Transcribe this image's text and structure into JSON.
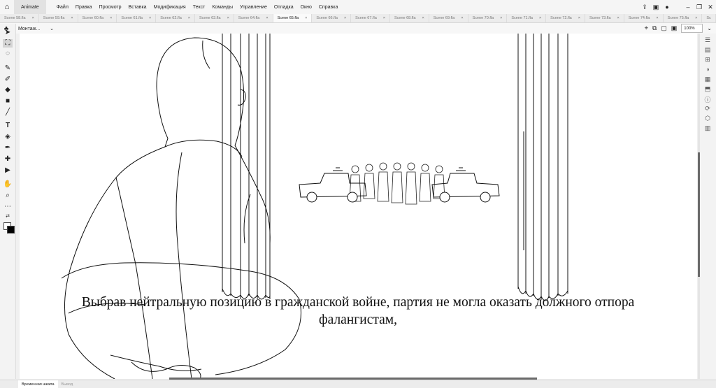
{
  "app": {
    "label": "Animate"
  },
  "menu": [
    "Файл",
    "Правка",
    "Просмотр",
    "Вставка",
    "Модификация",
    "Текст",
    "Команды",
    "Управление",
    "Отладка",
    "Окно",
    "Справка"
  ],
  "tabs": [
    {
      "label": "Scene 58.fla"
    },
    {
      "label": "Scene 59.fla"
    },
    {
      "label": "Scene 60.fla"
    },
    {
      "label": "Scene 61.fla"
    },
    {
      "label": "Scene 62.fla"
    },
    {
      "label": "Scene 63.fla"
    },
    {
      "label": "Scene 64.fla"
    },
    {
      "label": "Scene 65.fla",
      "active": true
    },
    {
      "label": "Scene 66.fla"
    },
    {
      "label": "Scene 67.fla"
    },
    {
      "label": "Scene 68.fla"
    },
    {
      "label": "Scene 69.fla"
    },
    {
      "label": "Scene 70.fla"
    },
    {
      "label": "Scene 71.fla"
    },
    {
      "label": "Scene 72.fla"
    },
    {
      "label": "Scene 73.fla"
    },
    {
      "label": "Scene 74.fla"
    },
    {
      "label": "Scene 75.fla"
    },
    {
      "label": "Sc"
    }
  ],
  "tab_close_glyph": "×",
  "scene_selector": {
    "label": "Монтаж..."
  },
  "zoom": {
    "value": "100%"
  },
  "subtitle": {
    "line1": "Выбрав нейтральную позицию в гражданской войне, партия не могла оказать должного отпора",
    "line2": "фалангистам,"
  },
  "bottom_tabs": [
    {
      "label": "Временная шкала",
      "active": true
    },
    {
      "label": "Вывод"
    }
  ],
  "icons": {
    "home": "home-icon",
    "share": "share-icon",
    "panels": "panels-icon",
    "play": "play-icon",
    "minimize": "minimize-icon",
    "restore": "restore-icon",
    "close": "close-icon"
  }
}
